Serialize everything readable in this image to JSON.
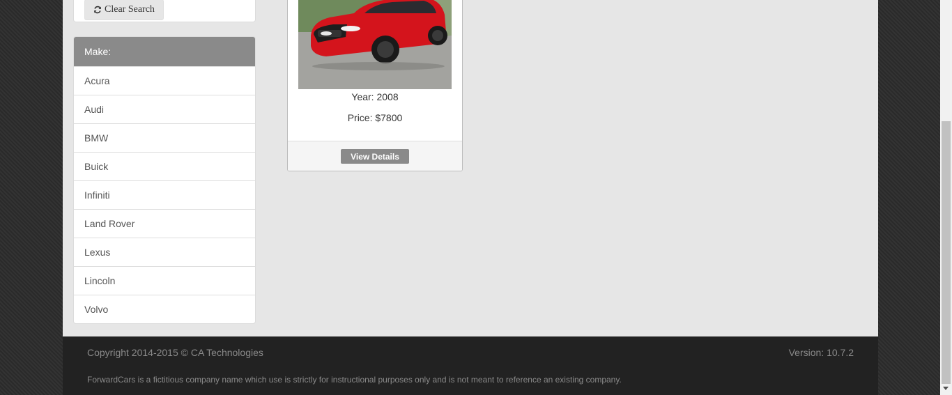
{
  "search": {
    "clear_label": "Clear Search",
    "clear_icon": "refresh-icon"
  },
  "make": {
    "header": "Make:",
    "items": [
      "Acura",
      "Audi",
      "BMW",
      "Buick",
      "Infiniti",
      "Land Rover",
      "Lexus",
      "Lincoln",
      "Volvo"
    ]
  },
  "car": {
    "year": "Year: 2008",
    "price": "Price: $7800",
    "details_label": "View Details",
    "car_color": "#d4141c"
  },
  "footer": {
    "copyright": "Copyright 2014-2015 © CA Technologies",
    "version": "Version: 10.7.2",
    "disclaimer": "ForwardCars is a fictitious company name which use is strictly for instructional purposes only and is not meant to reference an existing company."
  }
}
